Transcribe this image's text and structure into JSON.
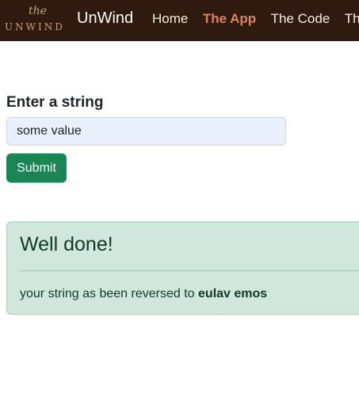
{
  "navbar": {
    "logo_the": "the",
    "logo_word": "UNWIND",
    "brand": "UnWind",
    "links": [
      {
        "label": "Home"
      },
      {
        "label": "The App"
      },
      {
        "label": "The Code"
      },
      {
        "label": "The Repo"
      }
    ]
  },
  "form": {
    "label": "Enter a string",
    "input_value": "some value",
    "submit_label": "Submit"
  },
  "alert": {
    "heading": "Well done!",
    "message_prefix": "your string as been reversed to ",
    "reversed_value": "eulav emos"
  }
}
